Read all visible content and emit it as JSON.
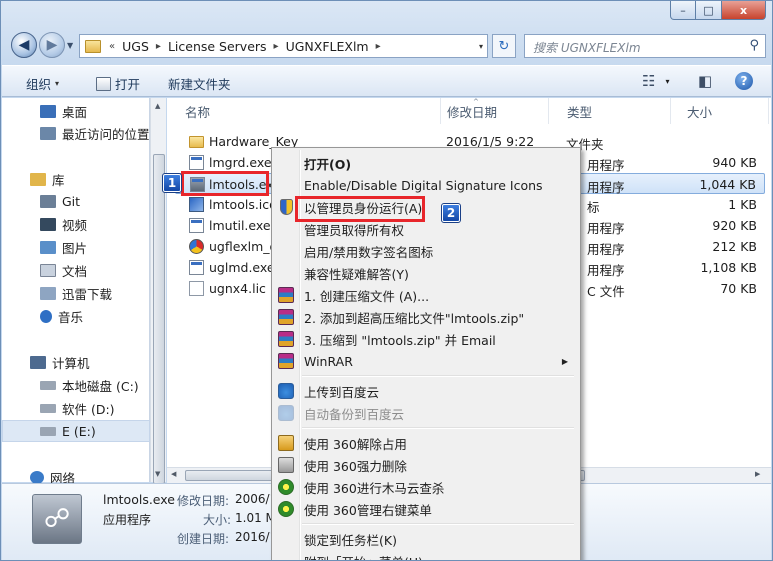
{
  "window": {
    "caption": {
      "min": "–",
      "max": "□",
      "close": "x"
    }
  },
  "address_bar": {
    "overflow": "«",
    "crumbs": [
      "UGS",
      "License Servers",
      "UGNXFLEXlm"
    ],
    "separator": "▸",
    "dropdown": "▾",
    "refresh": "↻"
  },
  "search": {
    "placeholder": "搜索 UGNXFLEXlm",
    "icon": "search-icon"
  },
  "toolbar": {
    "organize": "组织",
    "open": "打开",
    "new_folder": "新建文件夹",
    "caret": "▾",
    "view_icon": "☷",
    "pane_icon": "◧",
    "help": "?"
  },
  "nav": {
    "items": [
      {
        "label": "桌面",
        "icon": "desktop-icon",
        "color": "#3a6fb8"
      },
      {
        "label": "最近访问的位置",
        "icon": "recent-places-icon",
        "color": "#6b87a8"
      },
      {
        "label": "库",
        "icon": "libraries-icon",
        "color": "#e1b54a"
      },
      {
        "label": "Git",
        "icon": "git-library-icon",
        "color": "#6b7f97"
      },
      {
        "label": "视频",
        "icon": "video-icon",
        "color": "#34495e"
      },
      {
        "label": "图片",
        "icon": "pictures-icon",
        "color": "#5a8fc9"
      },
      {
        "label": "文档",
        "icon": "documents-icon",
        "color": "#c9d2de"
      },
      {
        "label": "迅雷下载",
        "icon": "thunder-download-icon",
        "color": "#8ea5c2"
      },
      {
        "label": "音乐",
        "icon": "music-icon",
        "color": "#2f6fc4"
      },
      {
        "label": "计算机",
        "icon": "computer-icon",
        "color": "#4d6a8f"
      },
      {
        "label": "本地磁盘 (C:)",
        "icon": "drive-c-icon",
        "color": "#9aa5b3"
      },
      {
        "label": "软件 (D:)",
        "icon": "drive-d-icon",
        "color": "#9aa5b3"
      },
      {
        "label": "E (E:)",
        "icon": "drive-e-icon",
        "color": "#9aa5b3"
      },
      {
        "label": "网络",
        "icon": "network-icon",
        "color": "#3a7bc8"
      }
    ]
  },
  "columns": {
    "name": "名称",
    "modified": "修改日期",
    "type": "类型",
    "size": "大小",
    "sort_arrow": "^"
  },
  "files": [
    {
      "name": "Hardware_Key",
      "date": "2016/1/5 9:22",
      "type": "文件夹",
      "size": "",
      "icon": "folder"
    },
    {
      "name": "lmgrd.exe",
      "date": "",
      "type": "用程序",
      "size": "940 KB",
      "icon": "exe"
    },
    {
      "name": "lmtools.exe",
      "date": "",
      "type": "用程序",
      "size": "1,044 KB",
      "icon": "exe"
    },
    {
      "name": "lmtools.ico",
      "date": "",
      "type": "标",
      "size": "1 KB",
      "icon": "ico"
    },
    {
      "name": "lmutil.exe",
      "date": "",
      "type": "用程序",
      "size": "920 KB",
      "icon": "exe"
    },
    {
      "name": "ugflexlm_o",
      "date": "",
      "type": "用程序",
      "size": "212 KB",
      "icon": "round"
    },
    {
      "name": "uglmd.exe",
      "date": "",
      "type": "用程序",
      "size": "1,108 KB",
      "icon": "exe"
    },
    {
      "name": "ugnx4.lic",
      "date": "",
      "type": "C 文件",
      "size": "70 KB",
      "icon": "doc"
    }
  ],
  "file_name_display": {
    "lmtools_truncated": "lmtools.ex",
    "ico_truncated": "lmtools.ico"
  },
  "context_menu": {
    "items": [
      {
        "label": "打开(O)",
        "bold": true
      },
      {
        "label": "Enable/Disable Digital Signature Icons"
      },
      {
        "label": "以管理员身份运行(A)",
        "icon": "uac-shield-icon"
      },
      {
        "label": "管理员取得所有权"
      },
      {
        "label": "启用/禁用数字签名图标"
      },
      {
        "label": "兼容性疑难解答(Y)"
      },
      {
        "label": "1. 创建压缩文件 (A)...",
        "icon": "winrar-icon"
      },
      {
        "label": "2. 添加到超高压缩比文件\"lmtools.zip\"",
        "icon": "winrar-icon"
      },
      {
        "label": "3. 压缩到 \"lmtools.zip\" 并 Email",
        "icon": "winrar-icon"
      },
      {
        "label": "WinRAR",
        "icon": "winrar-icon",
        "submenu": "▶"
      },
      {
        "label": "上传到百度云",
        "icon": "baidu-cloud-icon"
      },
      {
        "label": "自动备份到百度云",
        "icon": "baidu-cloud-icon",
        "disabled": true
      },
      {
        "label": "使用 360解除占用",
        "icon": "360-unlock-icon"
      },
      {
        "label": "使用 360强力删除",
        "icon": "360-shred-icon"
      },
      {
        "label": "使用 360进行木马云查杀",
        "icon": "360-scan-icon"
      },
      {
        "label": "使用 360管理右键菜单",
        "icon": "360-scan-icon"
      },
      {
        "label": "锁定到任务栏(K)"
      },
      {
        "label": "附到「开始」菜单(U)"
      }
    ]
  },
  "details": {
    "filename": "lmtools.exe",
    "type": "应用程序",
    "modified_label": "修改日期:",
    "modified_value": "2006/1",
    "size_label": "大小:",
    "size_value": "1.01 M",
    "created_label": "创建日期:",
    "created_value": "2016/1"
  },
  "annotations": {
    "badge1": "1",
    "badge2": "2",
    "highlight_color": "#e8262b"
  }
}
